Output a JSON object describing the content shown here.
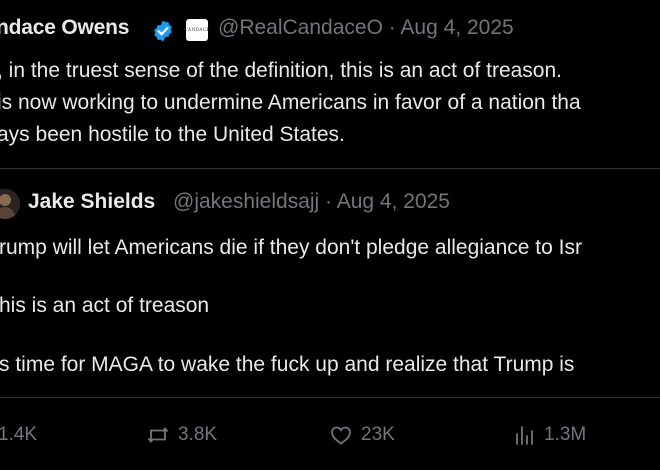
{
  "tweet": {
    "author_name": "ndace Owens",
    "affiliate_badge_text": "CANDACE",
    "meta": "@RealCandaceO · Aug 4, 2025",
    "body_lines": [
      ", in the truest sense of the definition, this is an act of treason.",
      "is now working to undermine Americans in favor of a nation tha",
      "ays been hostile to the United States."
    ]
  },
  "quote": {
    "author_name": "Jake Shields",
    "meta": "@jakeshieldsajj · Aug 4, 2025",
    "line1": "rump will let Americans die if they don't pledge allegiance to Isr",
    "line2": "his is an act of treason",
    "line3": "s time for MAGA to wake the fuck up and realize that Trump is"
  },
  "actions": {
    "replies": "1.4K",
    "reposts": "3.8K",
    "likes": "23K",
    "views": "1.3M"
  },
  "colors": {
    "background": "#000000",
    "text": "#e7e9ea",
    "muted": "#71767b",
    "verified": "#1d9bf0",
    "border": "#2f3336"
  },
  "icons": [
    "verified-badge-icon",
    "reply-icon",
    "repost-icon",
    "like-icon",
    "views-icon"
  ]
}
